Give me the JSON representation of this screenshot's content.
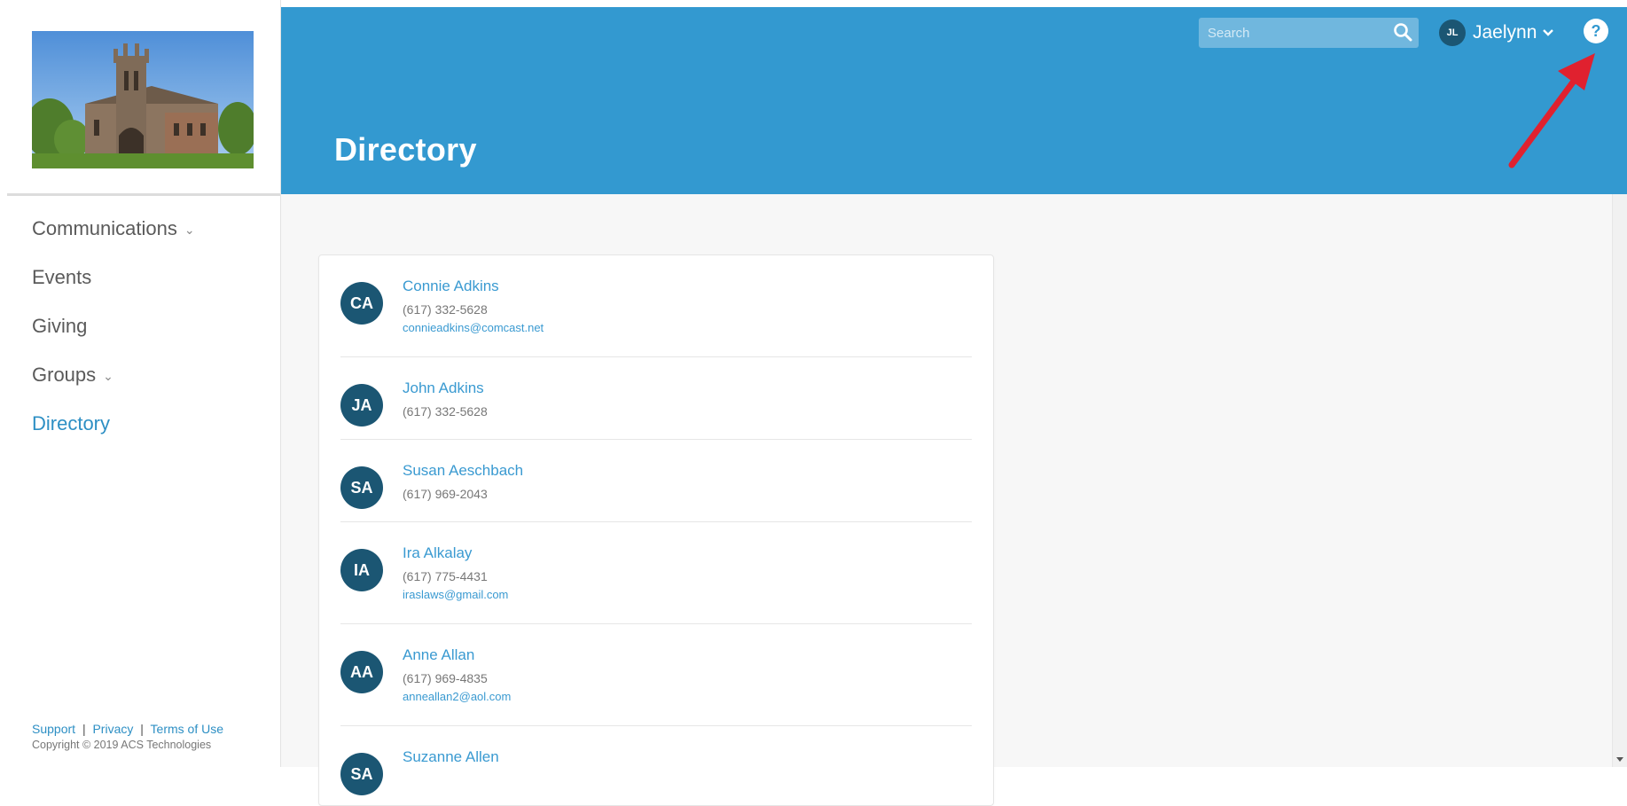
{
  "sidebar": {
    "logo": "church-logo",
    "nav": [
      {
        "label": "Communications",
        "has_submenu": true,
        "active": false
      },
      {
        "label": "Events",
        "has_submenu": false,
        "active": false
      },
      {
        "label": "Giving",
        "has_submenu": false,
        "active": false
      },
      {
        "label": "Groups",
        "has_submenu": true,
        "active": false
      },
      {
        "label": "Directory",
        "has_submenu": false,
        "active": true
      }
    ],
    "footer": {
      "support": "Support",
      "privacy": "Privacy",
      "terms": "Terms of Use",
      "separator": "|",
      "copyright": "Copyright © 2019 ACS Technologies"
    }
  },
  "header": {
    "title": "Directory",
    "search_placeholder": "Search",
    "user": {
      "initials": "JL",
      "name": "Jaelynn"
    },
    "help_label": "?"
  },
  "directory": [
    {
      "initials": "CA",
      "name": "Connie Adkins",
      "phone": "(617) 332-5628",
      "email": "connieadkins@comcast.net"
    },
    {
      "initials": "JA",
      "name": "John Adkins",
      "phone": "(617) 332-5628",
      "email": ""
    },
    {
      "initials": "SA",
      "name": "Susan Aeschbach",
      "phone": "(617) 969-2043",
      "email": ""
    },
    {
      "initials": "IA",
      "name": "Ira Alkalay",
      "phone": "(617) 775-4431",
      "email": "iraslaws@gmail.com"
    },
    {
      "initials": "AA",
      "name": "Anne Allan",
      "phone": "(617) 969-4835",
      "email": "anneallan2@aol.com"
    },
    {
      "initials": "SA",
      "name": "Suzanne Allen",
      "phone": "",
      "email": ""
    }
  ],
  "colors": {
    "header_bg": "#3399d0",
    "avatar_bg": "#1b5673",
    "link": "#3a9ad1",
    "active_nav": "#2d8fc4",
    "annotation_arrow": "#e0212f"
  }
}
